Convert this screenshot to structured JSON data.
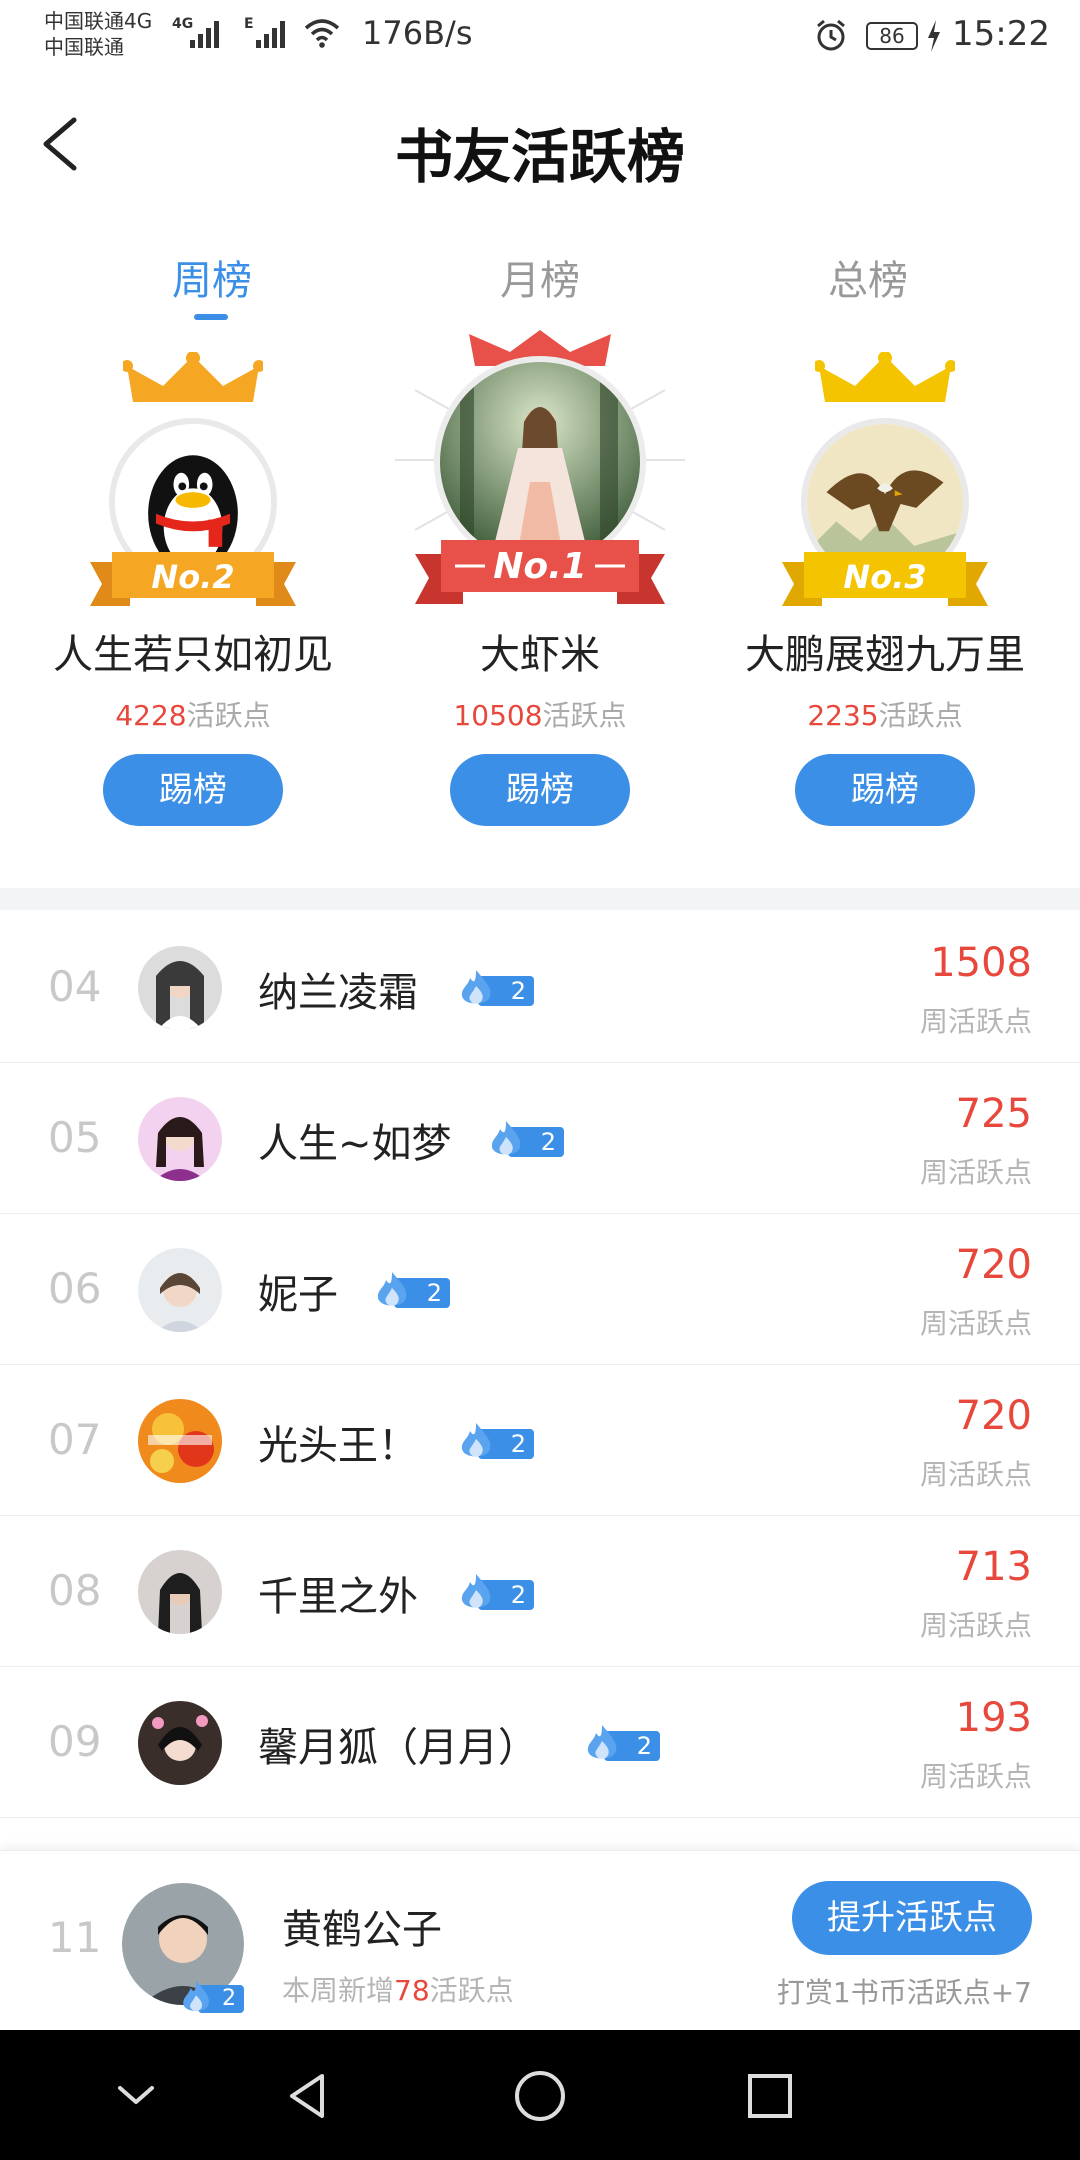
{
  "status_bar": {
    "carrier_line1": "中国联通4G",
    "carrier_line2": "中国联通",
    "net1": "4G",
    "net2": "E",
    "speed": "176B/s",
    "battery": "86",
    "time": "15:22"
  },
  "header": {
    "title": "书友活跃榜"
  },
  "tabs": [
    {
      "label": "周榜",
      "active": true
    },
    {
      "label": "月榜",
      "active": false
    },
    {
      "label": "总榜",
      "active": false
    }
  ],
  "podium": [
    {
      "badge": "No.2",
      "name": "人生若只如初见",
      "points": "4228",
      "points_suffix": "活跃点",
      "button": "踢榜"
    },
    {
      "badge": "No.1",
      "name": "大虾米",
      "points": "10508",
      "points_suffix": "活跃点",
      "button": "踢榜"
    },
    {
      "badge": "No.3",
      "name": "大鹏展翅九万里",
      "points": "2235",
      "points_suffix": "活跃点",
      "button": "踢榜"
    }
  ],
  "list": [
    {
      "rank": "04",
      "name": "纳兰凌霜",
      "level": "2",
      "score": "1508",
      "score_label": "周活跃点"
    },
    {
      "rank": "05",
      "name": "人生~如梦",
      "level": "2",
      "score": "725",
      "score_label": "周活跃点"
    },
    {
      "rank": "06",
      "name": "妮子",
      "level": "2",
      "score": "720",
      "score_label": "周活跃点"
    },
    {
      "rank": "07",
      "name": "光头王！",
      "level": "2",
      "score": "720",
      "score_label": "周活跃点"
    },
    {
      "rank": "08",
      "name": "千里之外",
      "level": "2",
      "score": "713",
      "score_label": "周活跃点"
    },
    {
      "rank": "09",
      "name": "馨月狐（月月）",
      "level": "2",
      "score": "193",
      "score_label": "周活跃点"
    }
  ],
  "me": {
    "rank": "11",
    "name": "黄鹤公子",
    "level": "2",
    "sub_prefix": "本周新增",
    "sub_num": "78",
    "sub_suffix": "活跃点",
    "button": "提升活跃点",
    "hint": "打赏1书币活跃点+7"
  },
  "colors": {
    "accent": "#3b8fe6",
    "score_red": "#e8473c",
    "gold": "#f5b800",
    "silver_orange": "#f5a623",
    "first_red": "#e8504a"
  },
  "icons": [
    "back-arrow-icon",
    "alarm-icon",
    "wifi-icon",
    "flame-level-icon",
    "crown-icon",
    "nav-down-icon",
    "nav-back-icon",
    "nav-home-icon",
    "nav-recents-icon"
  ]
}
